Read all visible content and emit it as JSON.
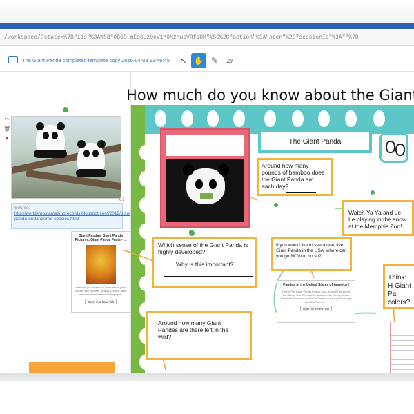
{
  "browser": {
    "url": "/workspace/?state=%7B\"ids\"%3A%5B\"0B6D-mEo6UzQoV1M0M2hweVRfeHM\"%5D%2C\"action\"%3A\"open\"%2C\"sessionId\"%3A\"\"%7D"
  },
  "app": {
    "document_title": "The Giant Panda completed template copy 2016-04-08 13:46:45",
    "icons": [
      "monitor-icon",
      "pointer-icon",
      "hand-icon",
      "pen-icon",
      "eraser-icon",
      "cut-icon",
      "trash-icon",
      "chevron-down-icon"
    ]
  },
  "left_panel": {
    "source_label": "Source:",
    "source_url": "http://worldsmostamazingrecords.blogspot.com/2012/giant-panda-endangered-species.html",
    "card": {
      "title": "Giant Pandas, Giant Panda Pictures, Giant Panda Facts - ...",
      "text": "Learn all you wanted to know about giant pandas with pictures, videos, photos, facts, and news from National Geographic.",
      "button": "Open in a New Tab"
    }
  },
  "board": {
    "title": "How much do you know about the Giant P",
    "header_card": "The Giant Panda",
    "questions": {
      "bamboo": "Around how many pounds of bamboo does the Giant Panda eat each day?",
      "sense": "Which sense of the Giant Panda is highly developed?",
      "why": "Why is this important?",
      "count": "Around how many Giant Pandas are there left in the wild?",
      "zoo": "If you would like to see a real, live Giant Panda in the USA, where can you go NOW to do so?",
      "watch": "Watch Ya Ya and Le Le playing in the snow at the Memphis Zoo!",
      "think": "Think: H Giant Pa colors?"
    },
    "zoo_card": {
      "title": "Pandas in the United States of America |",
      "text": "Home The Giant Panda Panda Zoos Around The World San Diego Zoo Zoo Atlanta National Zoo Memphis Zoo Tiergarten Schönbrunn Ocean Park Hong Kong Edinburgh Zoo ZooParc de...",
      "button": "Open in a New Tab"
    }
  },
  "colors": {
    "accent_blue": "#2d79c7",
    "active_tool": "#2d88d6",
    "teal": "#5cc7c6",
    "green": "#78b943",
    "orange": "#f1b339",
    "pink_frame": "#e8687a"
  }
}
